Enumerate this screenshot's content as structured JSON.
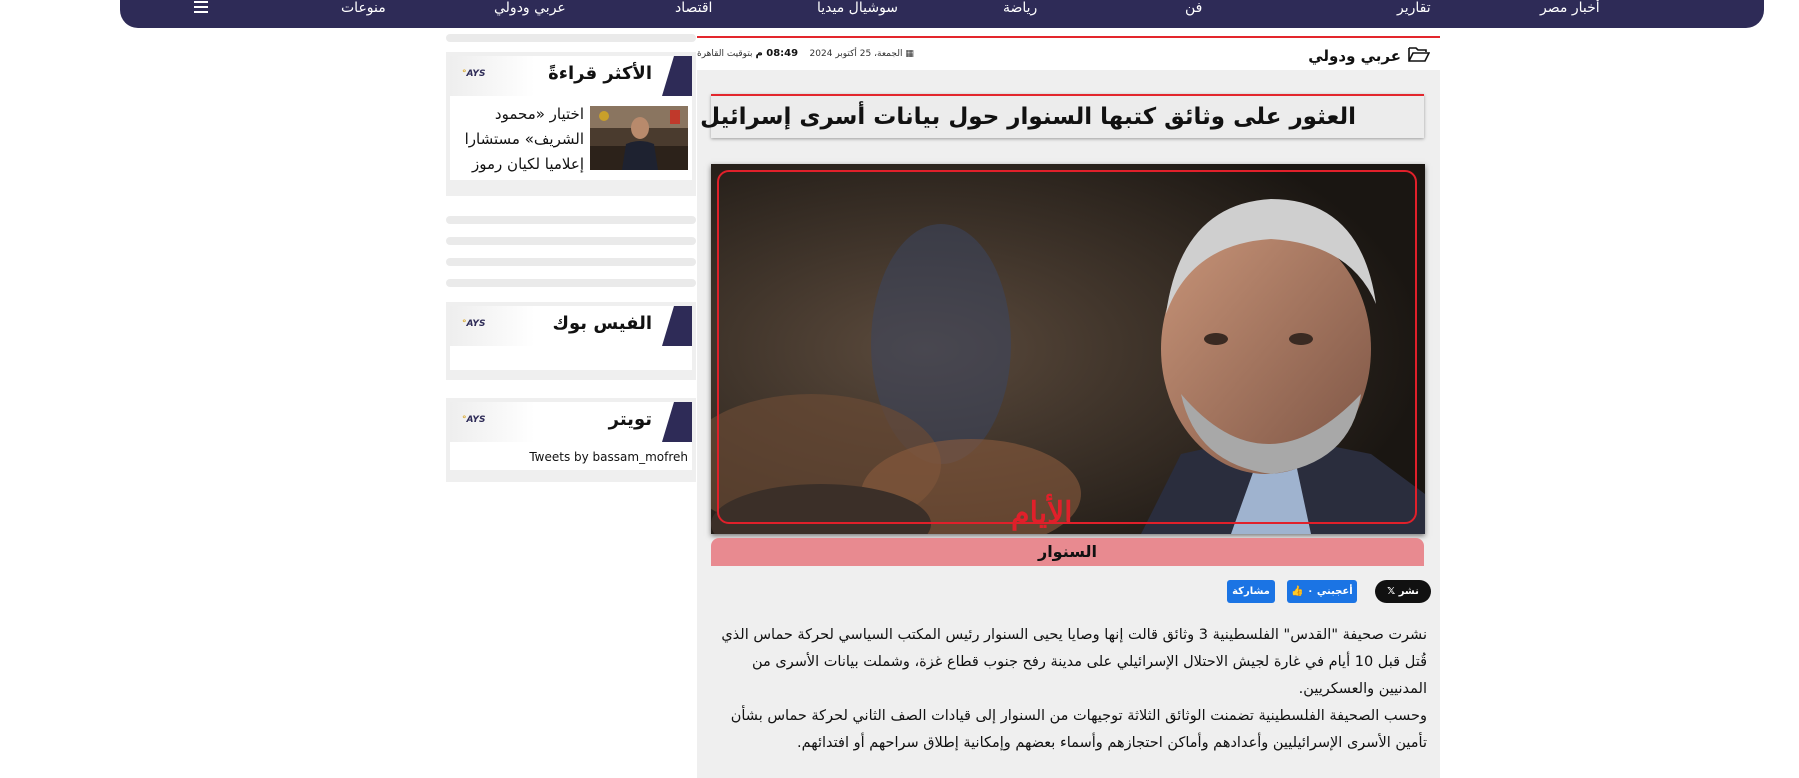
{
  "nav": {
    "items": [
      "أخبار مصر",
      "تقارير",
      "فن",
      "رياضة",
      "سوشيال ميديا",
      "اقتصاد",
      "عربي ودولي",
      "منوعات"
    ],
    "home_icon": "home-icon",
    "menu_icon": "hamburger-icon"
  },
  "article": {
    "category": "عربي ودولي",
    "date": "الجمعة، 25 أكتوبر 2024",
    "time": "08:49 م",
    "timezone": "بتوقيت القاهرة",
    "title": "العثور على وثائق كتبها السنوار حول بيانات أسرى إسرائيل",
    "photo_logo": "الأيام",
    "caption": "السنوار",
    "share": {
      "x_label": "نشر",
      "like_label": "أعجبني ٠",
      "share_label": "مشاركة"
    },
    "paragraphs": [
      "نشرت صحيفة \"القدس\" الفلسطينية 3 وثائق قالت إنها وصايا يحيى السنوار رئيس المكتب السياسي لحركة حماس الذي قُتل قبل 10 أيام في غارة لجيش الاحتلال الإسرائيلي على مدينة رفح جنوب قطاع غزة، وشملت بيانات الأسرى من المدنيين والعسكريين.",
      "وحسب الصحيفة الفلسطينية تضمنت الوثائق الثلاثة توجيهات من السنوار إلى قيادات الصف الثاني لحركة حماس بشأن تأمين الأسرى الإسرائيليين وأعدادهم وأماكن احتجازهم وأسماء بعضهم وإمكانية إطلاق سراحهم أو افتدائهم."
    ]
  },
  "sidebar": {
    "most_read": {
      "title": "الأكثر قراءةً",
      "item": "اختيار «محمود الشريف» مستشارا إعلاميا لكيان رموز"
    },
    "facebook": {
      "title": "الفيس بوك"
    },
    "twitter": {
      "title": "تويتر",
      "tweets_by": "Tweets by bassam_mofreh"
    },
    "logo_text": "AYS"
  }
}
